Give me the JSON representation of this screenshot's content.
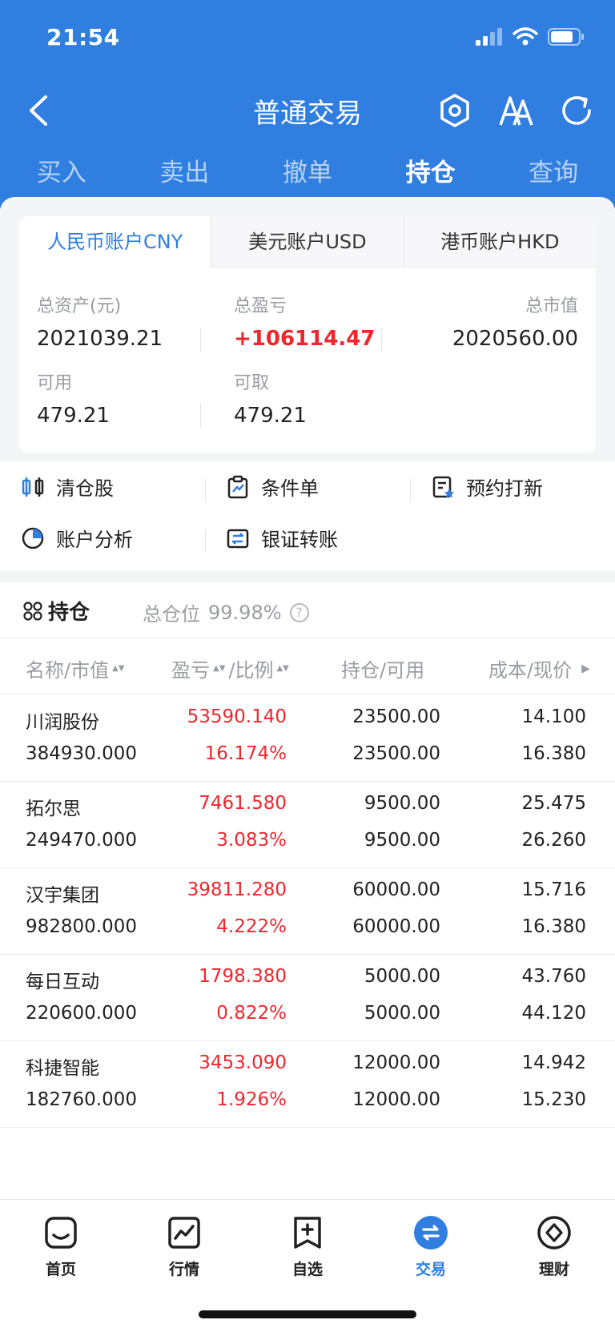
{
  "status": {
    "time": "21:54"
  },
  "nav": {
    "title": "普通交易"
  },
  "trade_tabs": [
    "买入",
    "卖出",
    "撤单",
    "持仓",
    "查询"
  ],
  "trade_tab_active": "持仓",
  "currency_tabs": [
    "人民币账户CNY",
    "美元账户USD",
    "港币账户HKD"
  ],
  "currency_tab_active": "人民币账户CNY",
  "assets": {
    "total_assets_label": "总资产(元)",
    "total_assets": "2021039.21",
    "total_pl_label": "总盈亏",
    "total_pl": "+106114.47",
    "market_value_label": "总市值",
    "market_value": "2020560.00",
    "available_label": "可用",
    "available": "479.21",
    "withdrawable_label": "可取",
    "withdrawable": "479.21"
  },
  "shortcuts": {
    "clear_stock": "清仓股",
    "conditional_order": "条件单",
    "ipo_reserve": "预约打新",
    "account_analysis": "账户分析",
    "bank_transfer": "银证转账"
  },
  "holdings": {
    "title": "持仓",
    "position_label": "总仓位",
    "position_value": "99.98%",
    "help": "?",
    "columns": {
      "name": "名称/市值",
      "pl": "盈亏",
      "ratio": "/比例",
      "hold": "持仓/可用",
      "cost": "成本/现价"
    },
    "rows": [
      {
        "name": "川润股份",
        "mv": "384930.000",
        "pl": "53590.140",
        "ratio": "16.174%",
        "hold": "23500.00",
        "avail": "23500.00",
        "cost": "14.100",
        "price": "16.380"
      },
      {
        "name": "拓尔思",
        "mv": "249470.000",
        "pl": "7461.580",
        "ratio": "3.083%",
        "hold": "9500.00",
        "avail": "9500.00",
        "cost": "25.475",
        "price": "26.260"
      },
      {
        "name": "汉宇集团",
        "mv": "982800.000",
        "pl": "39811.280",
        "ratio": "4.222%",
        "hold": "60000.00",
        "avail": "60000.00",
        "cost": "15.716",
        "price": "16.380"
      },
      {
        "name": "每日互动",
        "mv": "220600.000",
        "pl": "1798.380",
        "ratio": "0.822%",
        "hold": "5000.00",
        "avail": "5000.00",
        "cost": "43.760",
        "price": "44.120"
      },
      {
        "name": "科捷智能",
        "mv": "182760.000",
        "pl": "3453.090",
        "ratio": "1.926%",
        "hold": "12000.00",
        "avail": "12000.00",
        "cost": "14.942",
        "price": "15.230"
      }
    ]
  },
  "tabbar": [
    "首页",
    "行情",
    "自选",
    "交易",
    "理财"
  ],
  "tabbar_active": "交易",
  "colors": {
    "primary": "#2f7ee0",
    "profit": "#f0262d"
  }
}
